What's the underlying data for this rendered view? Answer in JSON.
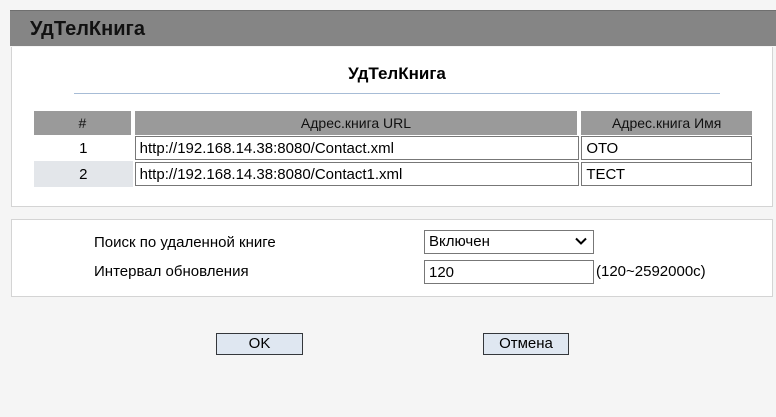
{
  "header": {
    "title": "УдТелКнига"
  },
  "book": {
    "title": "УдТелКнига",
    "columns": [
      "#",
      "Адрес.книга URL",
      "Адрес.книга Имя"
    ],
    "rows": [
      {
        "num": "1",
        "url": "http://192.168.14.38:8080/Contact.xml",
        "name": "ОТО"
      },
      {
        "num": "2",
        "url": "http://192.168.14.38:8080/Contact1.xml",
        "name": "ТЕСТ"
      }
    ]
  },
  "settings": {
    "search_label": "Поиск по удаленной книге",
    "search_value": "Включен",
    "interval_label": "Интервал обновления",
    "interval_value": "120",
    "interval_hint": "(120~2592000с)"
  },
  "buttons": {
    "ok": "OK",
    "cancel": "Отмена"
  },
  "icons": {
    "dropdown": "chevron-down-icon"
  }
}
